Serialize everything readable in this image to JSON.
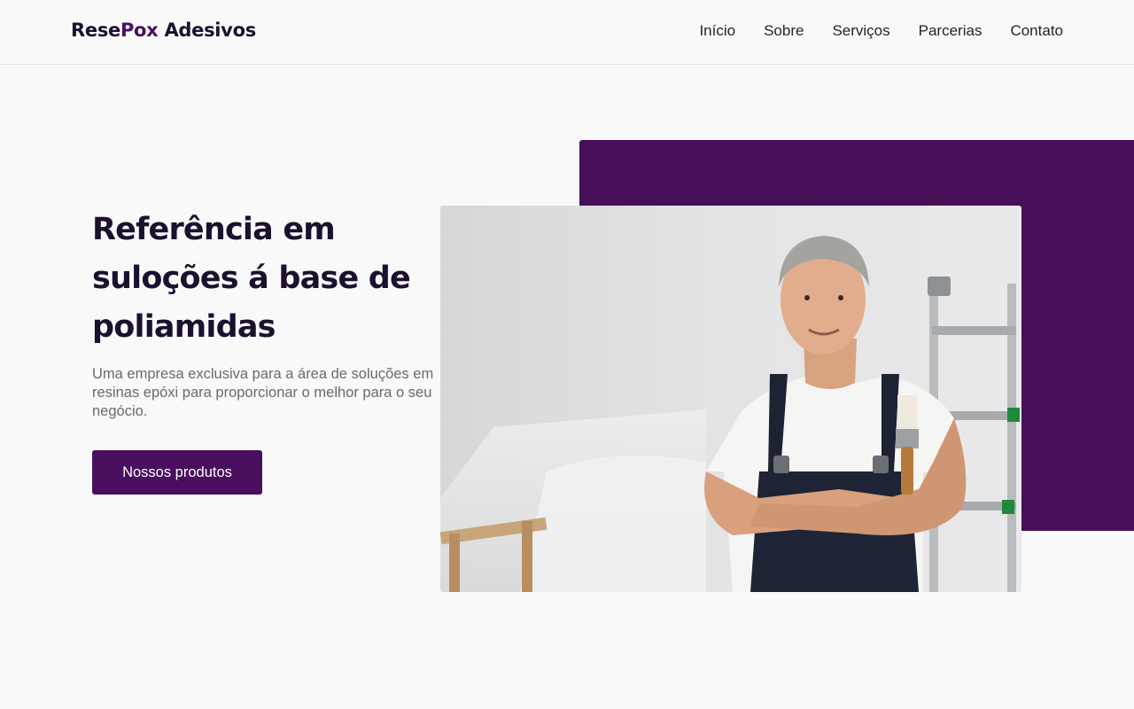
{
  "brand": {
    "name_part1": "Rese",
    "name_part2": "Pox",
    "name_part3": " Adesivos",
    "accent_color": "#4a1060"
  },
  "nav": {
    "items": [
      {
        "label": "Início"
      },
      {
        "label": "Sobre"
      },
      {
        "label": "Serviços"
      },
      {
        "label": "Parcerias"
      },
      {
        "label": "Contato"
      }
    ]
  },
  "hero": {
    "title": "Referência em suloções á base de poliamidas",
    "description": "Uma empresa exclusiva para a área de soluções em resinas epóxi para proporcionar o melhor para o seu negócio.",
    "cta_label": "Nossos produtos",
    "image_icon": "worker-photo",
    "block_color": "#460f57",
    "button_color": "#4a0e5e"
  }
}
